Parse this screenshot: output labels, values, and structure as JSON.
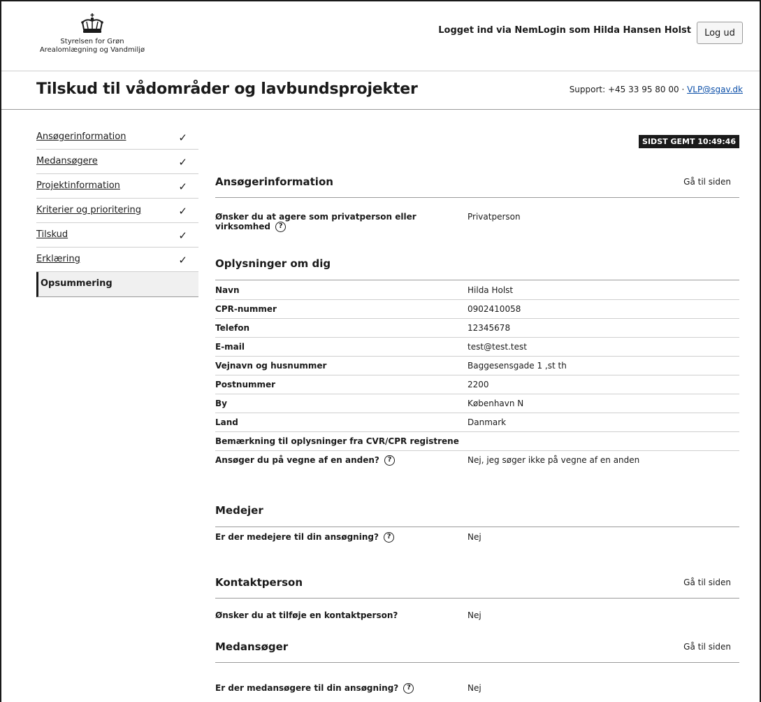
{
  "header": {
    "logo_line1": "Styrelsen for Grøn",
    "logo_line2": "Arealomlægning og Vandmiljø",
    "login_text": "Logget ind via NemLogin som Hilda Hansen Holst",
    "logout_label": "Log ud"
  },
  "titlebar": {
    "title": "Tilskud til vådområder og lavbundsprojekter",
    "support_prefix": "Support: +45 33 95 80 00 · ",
    "support_email": "VLP@sgav.dk"
  },
  "sidebar": {
    "items": [
      {
        "label": "Ansøgerinformation",
        "check": "✓"
      },
      {
        "label": "Medansøgere",
        "check": "✓"
      },
      {
        "label": "Projektinformation",
        "check": "✓"
      },
      {
        "label": "Kriterier og prioritering",
        "check": "✓"
      },
      {
        "label": "Tilskud",
        "check": "✓"
      },
      {
        "label": "Erklæring",
        "check": "✓"
      },
      {
        "label": "Opsummering"
      }
    ]
  },
  "main": {
    "saved_badge": "SIDST GEMT 10:49:46",
    "goto_label": "Gå til siden",
    "sec_ansoger": {
      "title": "Ansøgerinformation",
      "q1_label": "Ønsker du at agere som privatperson eller virksomhed",
      "q1_value": "Privatperson"
    },
    "oplysninger": {
      "title": "Oplysninger om dig",
      "rows": [
        {
          "k": "Navn",
          "v": "Hilda Holst"
        },
        {
          "k": "CPR-nummer",
          "v": "0902410058"
        },
        {
          "k": "Telefon",
          "v": "12345678"
        },
        {
          "k": "E-mail",
          "v": "test@test.test"
        },
        {
          "k": "Vejnavn og husnummer",
          "v": "Baggesensgade 1 ,st th"
        },
        {
          "k": "Postnummer",
          "v": "2200"
        },
        {
          "k": "By",
          "v": "København N"
        },
        {
          "k": "Land",
          "v": "Danmark"
        },
        {
          "k": "Bemærkning til oplysninger fra CVR/CPR registrene",
          "v": ""
        }
      ],
      "vegne_label": "Ansøger du på vegne af en anden?",
      "vegne_value": "Nej, jeg søger ikke på vegne af en anden"
    },
    "medejer": {
      "title": "Medejer",
      "q_label": "Er der medejere til din ansøgning?",
      "q_value": "Nej"
    },
    "kontakt": {
      "title": "Kontaktperson",
      "q_label": "Ønsker du at tilføje en kontaktperson?",
      "q_value": "Nej"
    },
    "medansoger": {
      "title": "Medansøger",
      "q_label": "Er der medansøgere til din ansøgning?",
      "q_value": "Nej"
    },
    "help_glyph": "?"
  }
}
